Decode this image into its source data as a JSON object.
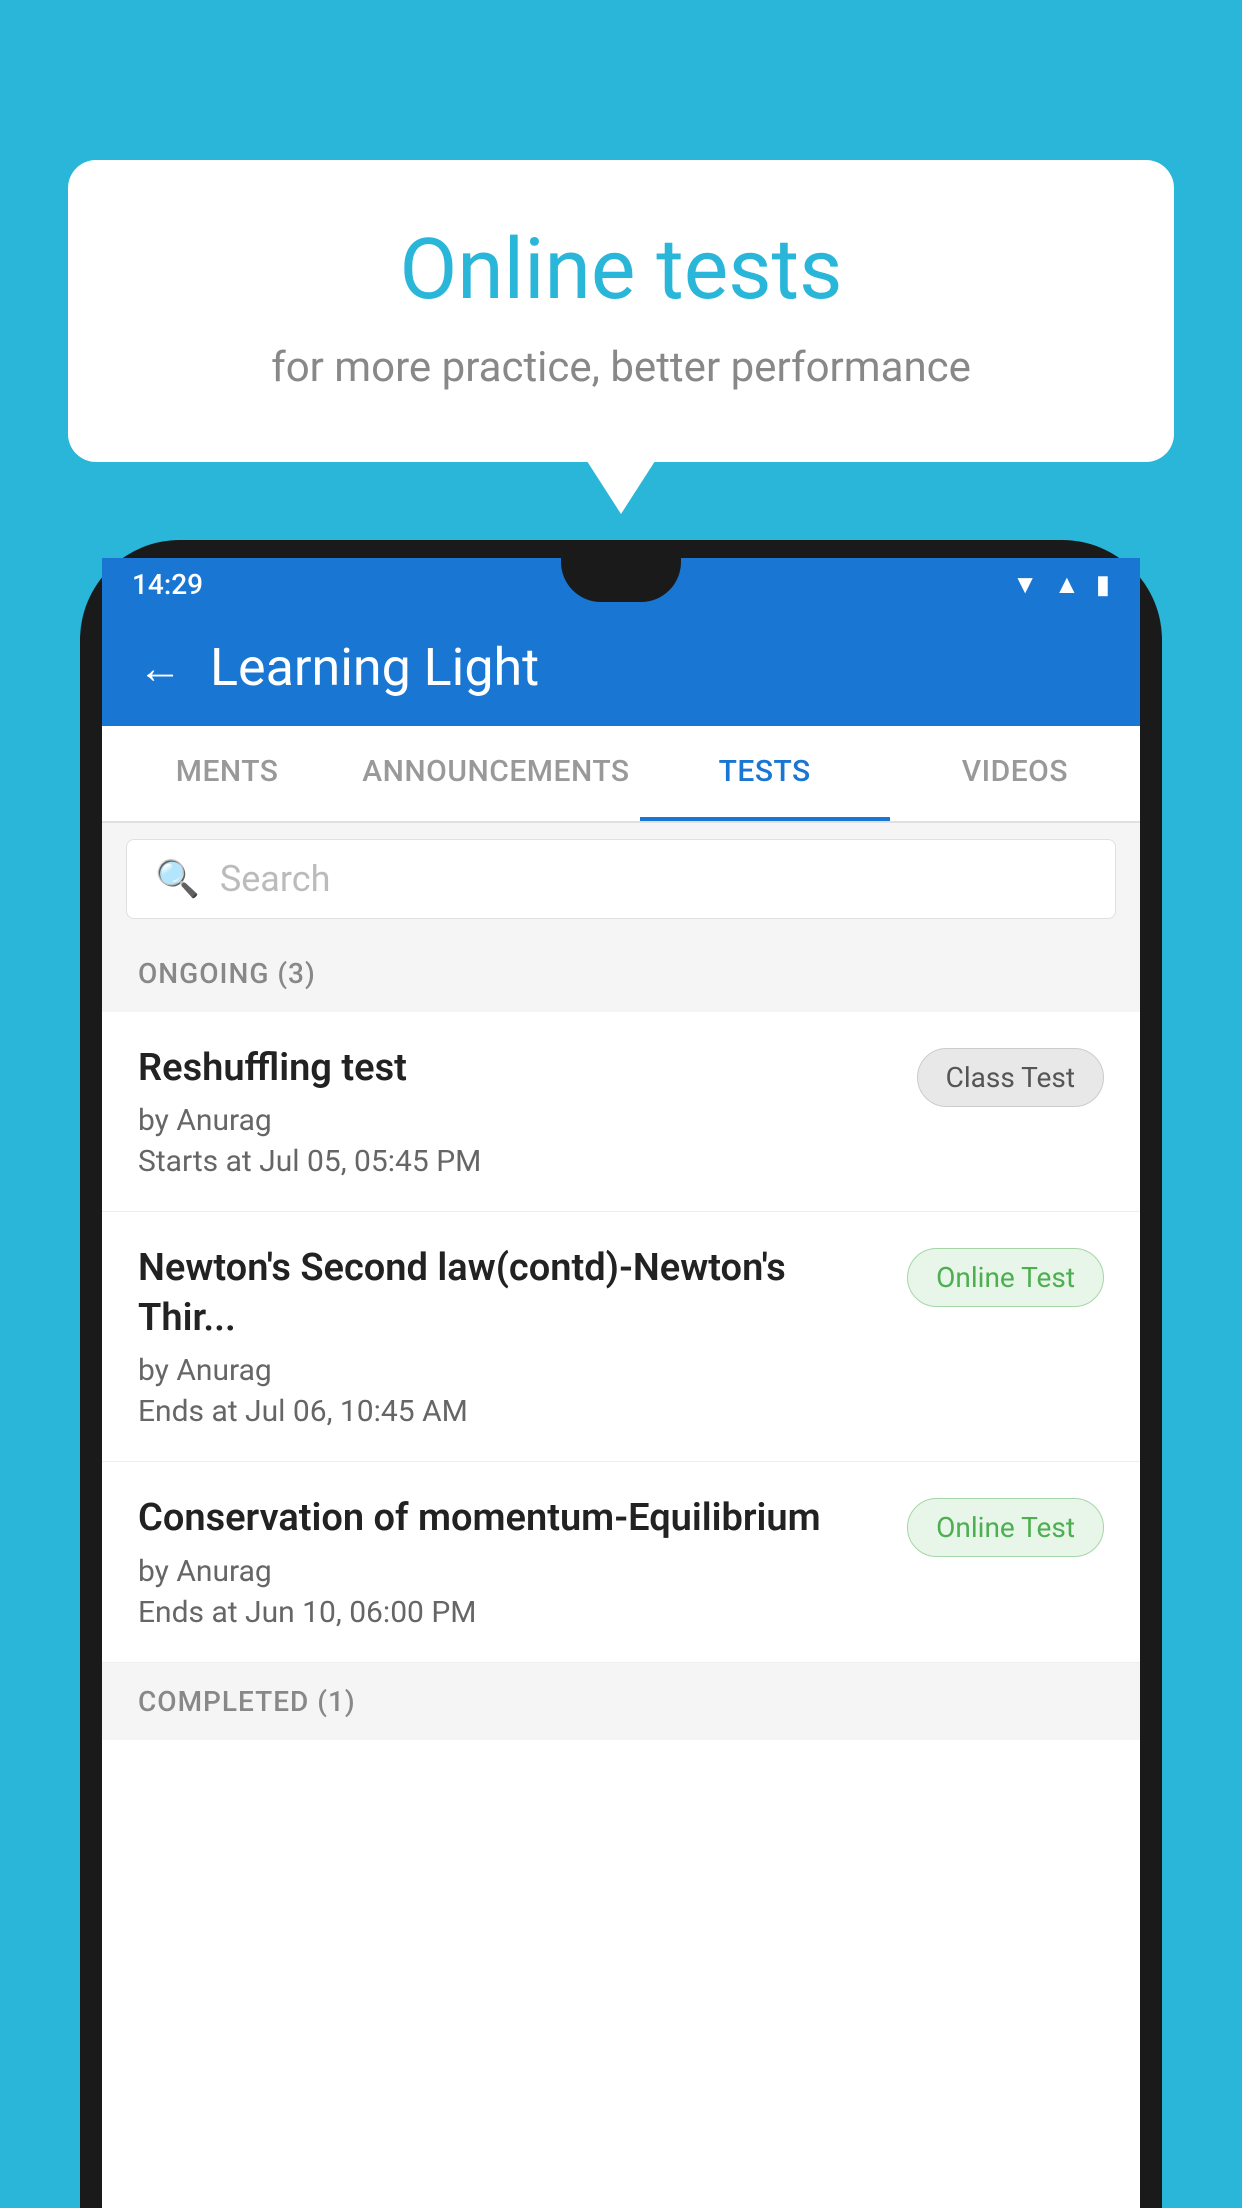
{
  "background_color": "#29b6d8",
  "speech_bubble": {
    "title": "Online tests",
    "subtitle": "for more practice, better performance"
  },
  "phone": {
    "time": "14:29",
    "status_icons": [
      "wifi",
      "signal",
      "battery"
    ]
  },
  "app": {
    "header": {
      "title": "Learning Light",
      "back_label": "←"
    },
    "tabs": [
      {
        "label": "MENTS",
        "active": false
      },
      {
        "label": "ANNOUNCEMENTS",
        "active": false
      },
      {
        "label": "TESTS",
        "active": true
      },
      {
        "label": "VIDEOS",
        "active": false
      }
    ],
    "search": {
      "placeholder": "Search"
    },
    "section_ongoing": "ONGOING (3)",
    "tests": [
      {
        "title": "Reshuffling test",
        "by": "by Anurag",
        "date": "Starts at  Jul 05, 05:45 PM",
        "badge": "Class Test",
        "badge_type": "class"
      },
      {
        "title": "Newton's Second law(contd)-Newton's Thir...",
        "by": "by Anurag",
        "date": "Ends at  Jul 06, 10:45 AM",
        "badge": "Online Test",
        "badge_type": "online"
      },
      {
        "title": "Conservation of momentum-Equilibrium",
        "by": "by Anurag",
        "date": "Ends at  Jun 10, 06:00 PM",
        "badge": "Online Test",
        "badge_type": "online"
      }
    ],
    "section_completed": "COMPLETED (1)"
  }
}
